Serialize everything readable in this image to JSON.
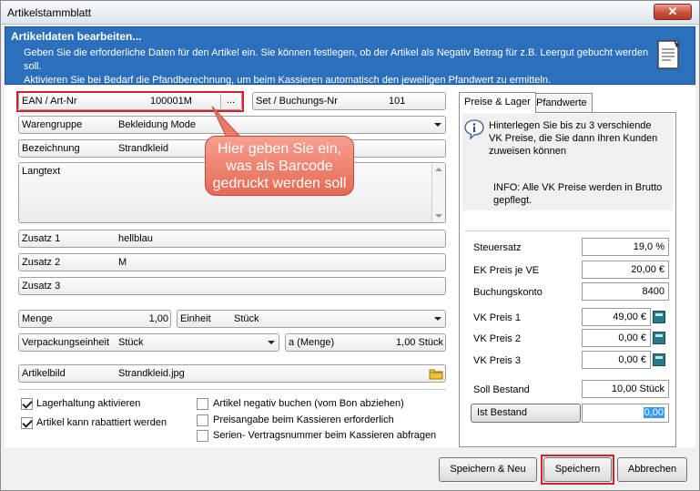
{
  "window": {
    "title": "Artikelstammblatt",
    "close_glyph": "✕"
  },
  "header": {
    "title": "Artikeldaten bearbeiten...",
    "text1": "Geben Sie die erforderliche Daten für den Artikel ein. Sie können festlegen, ob der Artikel als Negativ Betrag für z.B. Leergut gebucht werden soll.",
    "text2": "Aktivieren Sie bei Bedarf die Pfandberechnung, um beim Kassieren automatisch den jeweiligen Pfandwert zu ermitteln.",
    "icon": "document-icon"
  },
  "form": {
    "ean": {
      "label": "EAN / Art-Nr",
      "value": "100001M",
      "button": "..."
    },
    "set": {
      "label": "Set / Buchungs-Nr",
      "value": "101"
    },
    "warengruppe": {
      "label": "Warengruppe",
      "value": "Bekleidung Mode"
    },
    "bezeichnung": {
      "label": "Bezeichnung",
      "value": "Strandkleid"
    },
    "langtext": {
      "label": "Langtext",
      "value": ""
    },
    "zusatz1": {
      "label": "Zusatz 1",
      "value": "hellblau"
    },
    "zusatz2": {
      "label": "Zusatz 2",
      "value": "M"
    },
    "zusatz3": {
      "label": "Zusatz 3",
      "value": ""
    },
    "menge": {
      "label": "Menge",
      "value": "1,00"
    },
    "einheit": {
      "label": "Einheit",
      "value": "Stück"
    },
    "verpackung": {
      "label": "Verpackungseinheit",
      "value": "Stück"
    },
    "amenge": {
      "label": "a (Menge)",
      "value": "1,00 Stück"
    },
    "artikelbild": {
      "label": "Artikelbild",
      "value": "Strandkleid.jpg",
      "icon": "folder-icon"
    }
  },
  "callout": {
    "line1": "Hier geben Sie ein,",
    "line2": "was als Barcode",
    "line3": "gedruckt werden soll"
  },
  "checks": {
    "lagerhaltung": {
      "label": "Lagerhaltung aktivieren",
      "checked": true
    },
    "rabattiert": {
      "label": "Artikel kann rabattiert werden",
      "checked": true
    },
    "negativ": {
      "label": "Artikel negativ buchen (vom Bon abziehen)",
      "checked": false
    },
    "preisangabe": {
      "label": "Preisangabe beim Kassieren erforderlich",
      "checked": false
    },
    "serien": {
      "label": "Serien- Vertragsnummer beim Kassieren abfragen",
      "checked": false
    }
  },
  "tabs": {
    "preise": "Preise & Lager",
    "pfand": "Pfandwerte"
  },
  "info": {
    "text": "Hinterlegen Sie bis zu 3 verschiende VK Preise, die Sie dann Ihren Kunden zuweisen können",
    "note": "INFO: Alle VK Preise werden in Brutto gepflegt.",
    "icon": "info-icon"
  },
  "prices": {
    "steuersatz": {
      "label": "Steuersatz",
      "value": "19,0 %"
    },
    "ek": {
      "label": "EK Preis je VE",
      "value": "20,00 €"
    },
    "konto": {
      "label": "Buchungskonto",
      "value": "8400"
    },
    "vk1": {
      "label": "VK Preis 1",
      "value": "49,00 €"
    },
    "vk2": {
      "label": "VK Preis 2",
      "value": "0,00 €"
    },
    "vk3": {
      "label": "VK Preis 3",
      "value": "0,00 €"
    },
    "soll": {
      "label": "Soll Bestand",
      "value": "10,00 Stück"
    },
    "ist": {
      "label": "Ist Bestand",
      "value": "0,00"
    }
  },
  "buttons": {
    "save_new": "Speichern & Neu",
    "save": "Speichern",
    "cancel": "Abbrechen"
  },
  "colors": {
    "header": "#2c6fbd",
    "highlight": "#d8202a",
    "callout": "#e56954"
  }
}
